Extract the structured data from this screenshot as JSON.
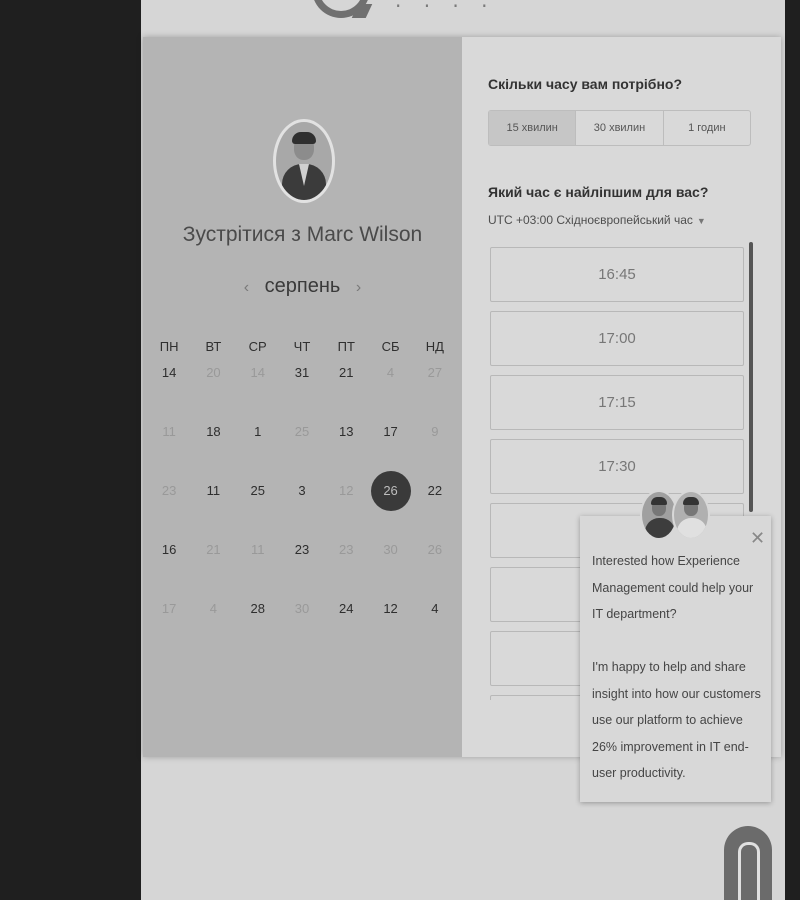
{
  "left": {
    "title": "Зустрітися з Marc Wilson",
    "month": "серпень",
    "prev_arrow": "‹",
    "next_arrow": "›",
    "weekdays": [
      "ПН",
      "ВТ",
      "СР",
      "ЧТ",
      "ПТ",
      "СБ",
      "НД"
    ],
    "weeks": [
      [
        {
          "d": "14",
          "dim": false
        },
        {
          "d": "20",
          "dim": true
        },
        {
          "d": "14",
          "dim": true
        },
        {
          "d": "31",
          "dim": false
        },
        {
          "d": "21",
          "dim": false
        },
        {
          "d": "4",
          "dim": true
        },
        {
          "d": "27",
          "dim": true
        }
      ],
      [
        {
          "d": "11",
          "dim": true
        },
        {
          "d": "18",
          "dim": false
        },
        {
          "d": "1",
          "dim": false
        },
        {
          "d": "25",
          "dim": true
        },
        {
          "d": "13",
          "dim": false
        },
        {
          "d": "17",
          "dim": false
        },
        {
          "d": "9",
          "dim": true
        }
      ],
      [
        {
          "d": "23",
          "dim": true
        },
        {
          "d": "11",
          "dim": false
        },
        {
          "d": "25",
          "dim": false
        },
        {
          "d": "3",
          "dim": false
        },
        {
          "d": "12",
          "dim": true
        },
        {
          "d": "26",
          "dim": false,
          "selected": true
        },
        {
          "d": "22",
          "dim": false
        }
      ],
      [
        {
          "d": "16",
          "dim": false
        },
        {
          "d": "21",
          "dim": true
        },
        {
          "d": "11",
          "dim": true
        },
        {
          "d": "23",
          "dim": false
        },
        {
          "d": "23",
          "dim": true
        },
        {
          "d": "30",
          "dim": true
        },
        {
          "d": "26",
          "dim": true
        }
      ],
      [
        {
          "d": "17",
          "dim": true
        },
        {
          "d": "4",
          "dim": true
        },
        {
          "d": "28",
          "dim": false
        },
        {
          "d": "30",
          "dim": true
        },
        {
          "d": "24",
          "dim": false
        },
        {
          "d": "12",
          "dim": false
        },
        {
          "d": "4",
          "dim": false
        }
      ]
    ]
  },
  "right": {
    "duration_question": "Скільки часу вам потрібно?",
    "durations": [
      {
        "label": "15 хвилин",
        "active": true
      },
      {
        "label": "30 хвилин",
        "active": false
      },
      {
        "label": "1 годин",
        "active": false
      }
    ],
    "time_question": "Який час є найліпшим для вас?",
    "timezone": "UTC +03:00 Східноєвропейський час",
    "timezone_caret": "▼",
    "slots": [
      "16:45",
      "17:00",
      "17:15",
      "17:30",
      "",
      "",
      "",
      ""
    ]
  },
  "popup": {
    "close": "✕",
    "text": "Interested how Experience Management could help your IT department?\n\nI'm happy to help and share insight into how our customers use our platform to achieve 26% improvement in IT end-user productivity."
  }
}
